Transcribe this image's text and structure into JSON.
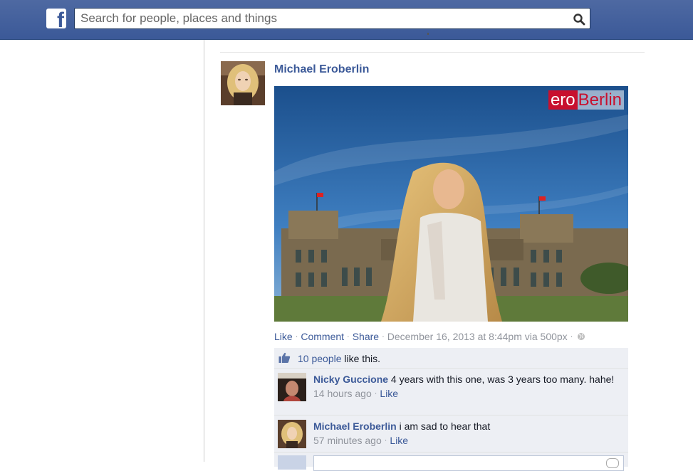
{
  "header": {
    "logo_icon": "facebook-f-icon",
    "search_placeholder": "Search for people, places and things",
    "search_icon": "magnifier-icon",
    "bar_color": "#3b5998"
  },
  "post": {
    "author": "Michael Eroberlin",
    "photo_watermark_ero": "ero",
    "photo_watermark_berlin": "Berlin",
    "actions": {
      "like": "Like",
      "comment": "Comment",
      "share": "Share",
      "timestamp": "December 16, 2013 at 8:44pm via 500px"
    }
  },
  "ufi": {
    "likes_count": "10 people",
    "likes_suffix": " like this.",
    "comments": [
      {
        "author": "Nicky Guccione",
        "text": " 4 years with this one, was 3 years too many. hahe!",
        "time": "14 hours ago",
        "like": "Like"
      },
      {
        "author": "Michael Eroberlin",
        "text": " i am sad to hear that",
        "time": "57 minutes ago",
        "like": "Like"
      }
    ]
  }
}
